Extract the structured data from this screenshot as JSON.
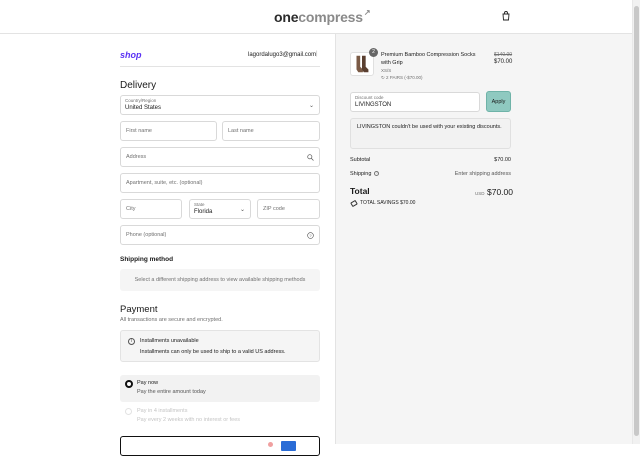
{
  "header": {
    "logo_main": "one",
    "logo_accent": "compress",
    "logo_mark": "↗"
  },
  "account": {
    "shop_label": "shop",
    "email": "lagordalugo3@gmail.com",
    "separator": "|"
  },
  "delivery": {
    "title": "Delivery",
    "country": {
      "label": "Country/Region",
      "value": "United States"
    },
    "first_name": {
      "placeholder": "First name"
    },
    "last_name": {
      "placeholder": "Last name"
    },
    "address": {
      "placeholder": "Address"
    },
    "apartment": {
      "placeholder": "Apartment, suite, etc. (optional)"
    },
    "city": {
      "placeholder": "City"
    },
    "state": {
      "label": "State",
      "value": "Florida"
    },
    "zip": {
      "placeholder": "ZIP code"
    },
    "phone": {
      "placeholder": "Phone (optional)"
    }
  },
  "shipping_method": {
    "title": "Shipping method",
    "message": "Select a different shipping address to view available shipping methods"
  },
  "payment": {
    "title": "Payment",
    "subtitle": "All transactions are secure and encrypted.",
    "installments_title": "Installments unavailable",
    "installments_text": "Installments can only be used to ship to a valid US address.",
    "pay_now_title": "Pay now",
    "pay_now_sub": "Pay the entire amount today",
    "pay4_title": "Pay in 4 installments",
    "pay4_sub": "Pay every 2 weeks with no interest or fees"
  },
  "order": {
    "item": {
      "quantity": "2",
      "name": "Premium Bamboo Compression Socks with Grip",
      "size": "XS/S",
      "bundle": "2 PAIRS (-$70.00)",
      "price_old": "$140.00",
      "price_new": "$70.00"
    },
    "discount": {
      "label": "Discount code",
      "value": "LIVINGSTON",
      "apply_label": "Apply"
    },
    "error": "LIVINGSTON couldn't be used with your existing discounts.",
    "subtotal_label": "Subtotal",
    "subtotal_value": "$70.00",
    "shipping_label": "Shipping",
    "shipping_value": "Enter shipping address",
    "total_label": "Total",
    "currency": "USD",
    "total_value": "$70.00",
    "savings_label": "TOTAL SAVINGS",
    "savings_value": "$70.00"
  },
  "colors": {
    "shop_purple": "#5a31f4",
    "apply_button": "#8fc9c0"
  },
  "icons": [
    "cart-icon",
    "chevron-down-icon",
    "search-icon",
    "help-icon",
    "info-icon",
    "tag-icon",
    "reload-icon"
  ]
}
